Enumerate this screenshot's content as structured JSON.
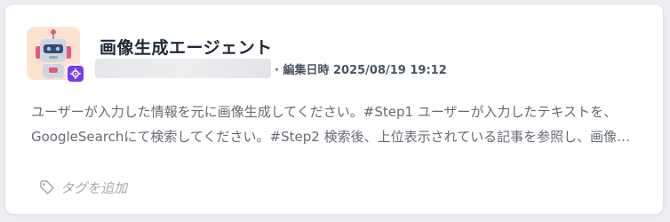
{
  "card": {
    "title": "画像生成エージェント",
    "meta": "· 編集日時 2025/08/19 19:12",
    "description_line1": "ユーザーが入力した情報を元に画像生成してください。#Step1 ユーザーが入力したテキストを、",
    "description_line2": "GoogleSearchにて検索してください。#Step2 検索後、上位表示されている記事を参照し、画像…",
    "tag_add_label": "タグを追加",
    "avatar_icon": "robot-icon",
    "badge_icon": "gear-icon",
    "tag_icon": "tag-icon"
  },
  "colors": {
    "accent": "#7c3aed",
    "avatar_bg": "#fde3cf"
  }
}
